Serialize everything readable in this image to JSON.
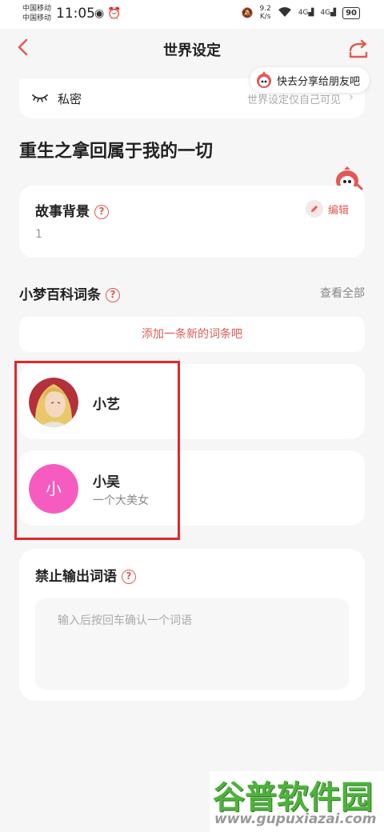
{
  "status_bar": {
    "carrier_1": "中国移动",
    "carrier_2": "中国移动",
    "time": "11:05",
    "net_speed_value": "9.2",
    "net_speed_unit": "K/s",
    "signal_1": "4G",
    "signal_2": "4G",
    "battery": "90"
  },
  "header": {
    "title": "世界设定"
  },
  "share_tip": {
    "text": "快去分享给朋友吧"
  },
  "privacy": {
    "label": "私密",
    "description": "世界设定仅自己可见"
  },
  "world": {
    "title": "重生之拿回属于我的一切"
  },
  "story": {
    "label": "故事背景",
    "edit_label": "编辑",
    "content": "1"
  },
  "wiki": {
    "label": "小梦百科词条",
    "view_all": "查看全部",
    "add_entry": "添加一条新的词条吧",
    "entries": [
      {
        "name": "小艺",
        "description": ""
      },
      {
        "name": "小吴",
        "description": "一个大美女",
        "avatar_letter": "小"
      }
    ]
  },
  "ban_words": {
    "label": "禁止输出词语",
    "placeholder": "输入后按回车确认一个词语"
  },
  "watermark": {
    "logo": "谷普软件园",
    "url": "www.gupuxiazai.com"
  },
  "colors": {
    "accent": "#e05a55",
    "highlight": "#e0282e",
    "avatar_pink": "#f65cbf",
    "background": "#f6f6f6"
  }
}
